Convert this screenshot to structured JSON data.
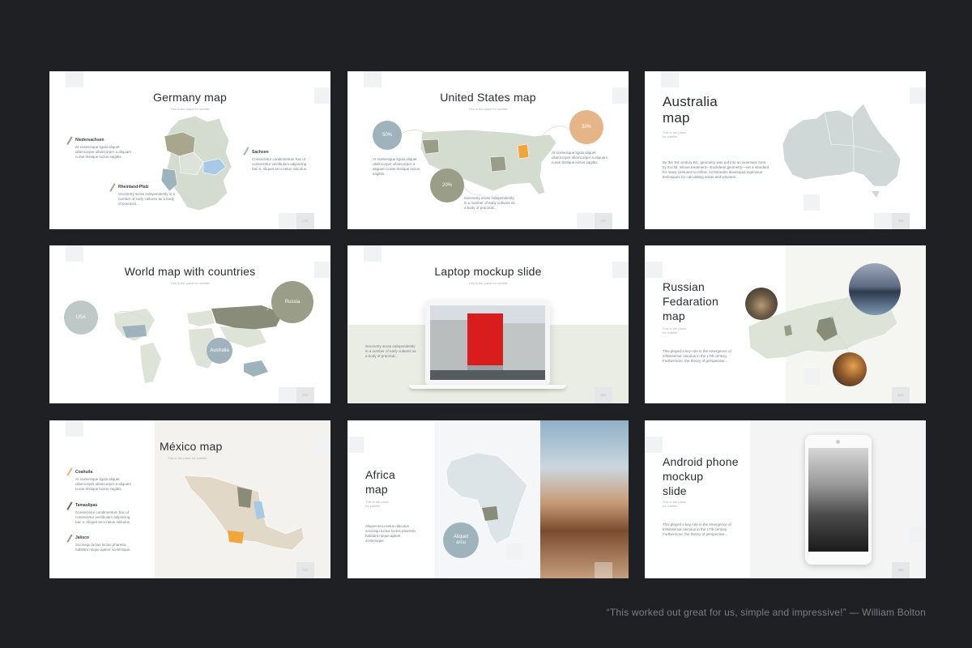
{
  "slides": [
    {
      "title": "Germany map",
      "subtitle": "This is the place for subtitle",
      "page": "1/24",
      "items": [
        {
          "label": "Niedersachsen",
          "text": "At scelerisque ligula aliquet ullamcorper ullamcorper a aliquam curae tristique luctus sagittis."
        },
        {
          "label": "Sachsen",
          "text": "Consectetur condimentum hac ut consectetur vestibulum adipiscing hac a. Aliquet arcu netus ridiculus."
        },
        {
          "label": "Rheinland-Pfalz",
          "text": "Geometry arose independently in a number of early cultures as a body of practical..."
        }
      ]
    },
    {
      "title": "United States map",
      "subtitle": "This is the place for subtitle",
      "page": "2/24",
      "stats": [
        "50%",
        "20%",
        "30%"
      ],
      "texts": [
        "At scelerisque ligula aliquet ullamcorper ullamcorper a aliquam curae tristique luctus sagittis.",
        "Geometry arose independently in a number of early cultures as a body of practical...",
        "At scelerisque ligula aliquet ullamcorper ullamcorper a aliquam curae tristique luctus sagittis."
      ]
    },
    {
      "title_line1": "Australia",
      "title_line2": "map",
      "subtitle_line1": "This is the place",
      "subtitle_line2": "for subtitle",
      "page": "3/24",
      "text": "By the 3rd century BC, geometry was put into an axiomatic form by Euclid, whose treatment—Euclidean geometry—set a standard for many centuries to follow. Archimedes developed ingenious techniques for calculating areas and volumes..."
    },
    {
      "title": "World map with countries",
      "subtitle": "This is the place for subtitle",
      "page": "4/24",
      "circles": [
        "USA",
        "Russia",
        "Australia"
      ]
    },
    {
      "title": "Laptop mockup slide",
      "subtitle": "This is the place for subtitle",
      "page": "5/24",
      "text": "Geometry arose independently in a number of early cultures as a body of practical..."
    },
    {
      "title_line1": "Russian",
      "title_line2": "Fedaration",
      "title_line3": "map",
      "subtitle_line1": "This is the place",
      "subtitle_line2": "for subtitle",
      "page": "6/24",
      "text": "This played a key role in the emergence of infinitesimal calculus in the 17th century. Furthermore, the theory of perspective..."
    },
    {
      "title": "México map",
      "subtitle": "This is the place for subtitle",
      "page": "7/24",
      "items": [
        {
          "label": "Coahuila",
          "text": "At scelerisque ligula aliquet ullamcorper ullamcorper a aliquam curae tristique luctus sagittis."
        },
        {
          "label": "Tamaulipas",
          "text": "Consectetur condimentum hac ut consectetur vestibulum adipiscing hac a. Aliquet arcu netus ridiculus."
        },
        {
          "label": "Jalisco",
          "text": "Sociosqu luctus luctus pharetra habitant neque aptent scelerisque."
        }
      ]
    },
    {
      "title_line1": "Africa",
      "title_line2": "map",
      "subtitle_line1": "This is the place",
      "subtitle_line2": "for subtitle",
      "page": "8/24",
      "circle_line1": "Aliquet",
      "circle_line2": "arcu",
      "text": "Aliquet arcu netus ridiculus sociosqu luctus luctus pharetra habitant neque aptent scelerisque."
    },
    {
      "title_line1": "Android phone",
      "title_line2": "mockup",
      "title_line3": "slide",
      "subtitle_line1": "This is the place",
      "subtitle_line2": "for subtitle",
      "page": "9/24",
      "text": "This played a key role in the emergence of infinitesimal calculus in the 17th century. Furthermore, the theory of perspective..."
    }
  ],
  "quote": "“This worked out great for us, simple and impressive!” — William Bolton",
  "colors": {
    "background": "#1e2024",
    "map_base": "#d4dcd0",
    "sage": "#9a9d88",
    "olive": "#a8a78d",
    "blue_grey": "#9fb3bc",
    "peach": "#e6b587",
    "orange": "#f0a63b",
    "blue": "#a7c9e6"
  }
}
